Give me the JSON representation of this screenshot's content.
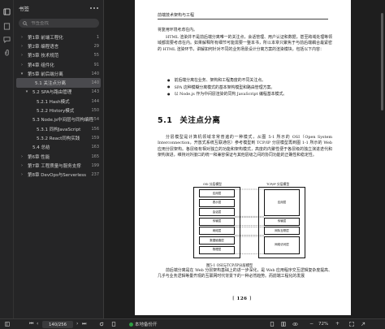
{
  "sidebar": {
    "title": "书签",
    "search_placeholder": "书签查找",
    "items": [
      {
        "label": "第1章  前端工程化",
        "page": "1",
        "level": 1
      },
      {
        "label": "第2章  编程语言",
        "page": "29",
        "level": 1
      },
      {
        "label": "第3章  技术规范",
        "page": "55",
        "level": 1
      },
      {
        "label": "第4章  组件化",
        "page": "91",
        "level": 1
      },
      {
        "label": "第5章  前后端分离",
        "page": "140",
        "level": 1,
        "expanded": true
      },
      {
        "label": "5.1  关注点分离",
        "page": "140",
        "level": 2,
        "active": true
      },
      {
        "label": "5.2  SPA与路由管理",
        "page": "143",
        "level": 2,
        "expanded": true
      },
      {
        "label": "5.2.1  Hash模式",
        "page": "144",
        "level": 3
      },
      {
        "label": "5.2.2  History模式",
        "page": "150",
        "level": 3
      },
      {
        "label": "5.3  Node.js中间层与同构编程",
        "page": "154",
        "level": 2
      },
      {
        "label": "5.3.1  同构JavaScript",
        "page": "156",
        "level": 3
      },
      {
        "label": "5.3.2  React同构实践",
        "page": "159",
        "level": 3
      },
      {
        "label": "5.4  总结",
        "page": "163",
        "level": 2
      },
      {
        "label": "第6章  性能",
        "page": "165",
        "level": 1
      },
      {
        "label": "第7章  工程质量与服务支撑",
        "page": "199",
        "level": 1
      },
      {
        "label": "第8章  DevOps与Serverless",
        "page": "237",
        "level": 1
      }
    ]
  },
  "document": {
    "running_head": "前端技术架构与工程",
    "intro": "将复用环境考虑在内。",
    "para1": "HTML 渲染并不是前后端分离唯一的关注点，会话管理、用户认证和数据，甚至跨域处理等领域都需要考虑在内。如果解释所有细节可能需要一整本书，所以本章只聚焦于与前后端耦合最紧密的 HTML 渲染环节，讲解如何针对不同的业务场景设计分离方案的渲染模块，包括以下内容：",
    "bullets": [
      "前后端分离在业务、架构和工程角度的不同关注点。",
      "SPA 这种模糊分离模式的基本架构模型和路由管理方案。",
      "以 Node.js 作为中间层渲染的同构 JavaScript 编程基本模式。"
    ],
    "section_number": "5.1",
    "section_title": "关注点分离",
    "para2": "分层模型是计算机领域非常普遍的一种模式，从图 5-1 所示的 OSI（Open System Interconnection，开放式系统互联通信）参考模型到 TCP/IP 分层模型再到图 1-1 所示的 Web 应用分层架构。各层级有相对独立的功能和架构模式，高度的内聚性便于各层级的独立演进迭代和架构演进，维持对外接口的统一和兼容保证与其他层级之间的协同功能的正确性和稳定性。",
    "figure": {
      "left_title": "OSI 分层模型",
      "right_title": "TCP/IP 分层模型",
      "osi_layers": [
        "应用层",
        "表示层",
        "会话层",
        "传输层",
        "网络层",
        "数据链路层",
        "物理层"
      ],
      "tcp_layers": [
        "应用层",
        "传输层",
        "网际互联层",
        "网络访问层"
      ],
      "caption": "图5-1   OSI与TCP/IP分层模型"
    },
    "para3": "前后端分离是在 Web 分层架构基础上的进一步深化，是 Web 应用程序交互逻辑复杂度提高、几乎与业务逻辑等量齐观的互联网时代背景下的一种必然趋势。而前端工程化的发展",
    "page_number": "126"
  },
  "statusbar": {
    "page_indicator": "140/256",
    "local_label": "本地备份开",
    "zoom": "72%"
  }
}
